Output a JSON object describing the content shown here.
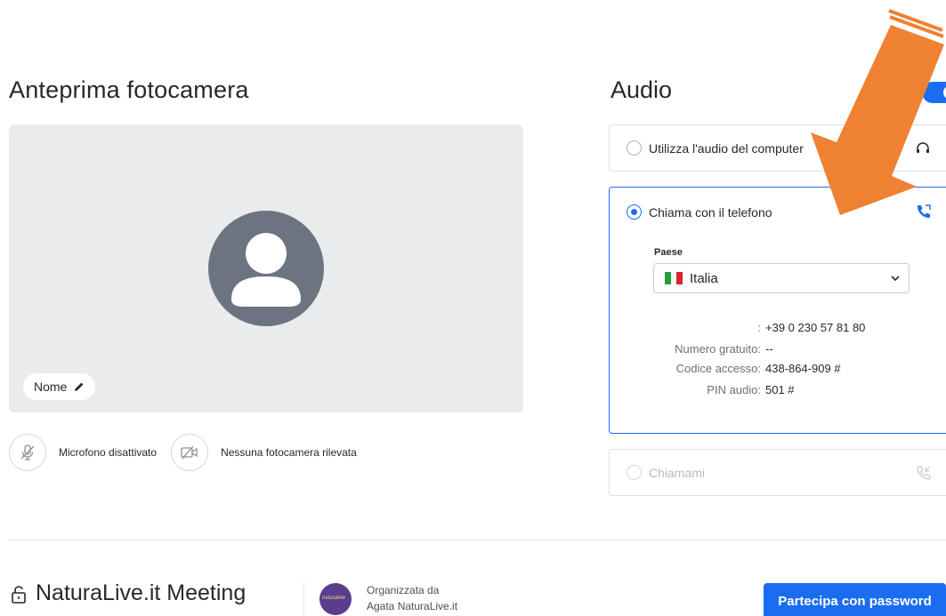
{
  "camera": {
    "title": "Anteprima fotocamera",
    "name_label": "Nome",
    "mic_label": "Microfono disattivato",
    "camera_label": "Nessuna fotocamera rilevata"
  },
  "audio": {
    "title": "Audio",
    "toggle_on": true,
    "options": {
      "computer": "Utilizza l'audio del computer",
      "phone": "Chiama con il telefono",
      "callme": "Chiamami"
    },
    "selected": "phone",
    "country_label": "Paese",
    "country_value": "Italia",
    "flag_colors": [
      "#1f9e3a",
      "#ffffff",
      "#d5262d"
    ],
    "dial_in": [
      {
        "key": ":",
        "value": "+39 0 230 57 81 80"
      },
      {
        "key": "Numero gratuito:",
        "value": "--"
      },
      {
        "key": "Codice accesso:",
        "value": "438-864-909 #"
      },
      {
        "key": "PIN audio:",
        "value": "501 #"
      }
    ]
  },
  "footer": {
    "meeting_title": "NaturaLive.it Meeting",
    "organizer_line1": "Organizzata da",
    "organizer_line2": "Agata NaturaLive.it",
    "join_button": "Partecipa con password"
  },
  "colors": {
    "accent": "#1a6df0",
    "annotation_arrow": "#ef8133"
  }
}
